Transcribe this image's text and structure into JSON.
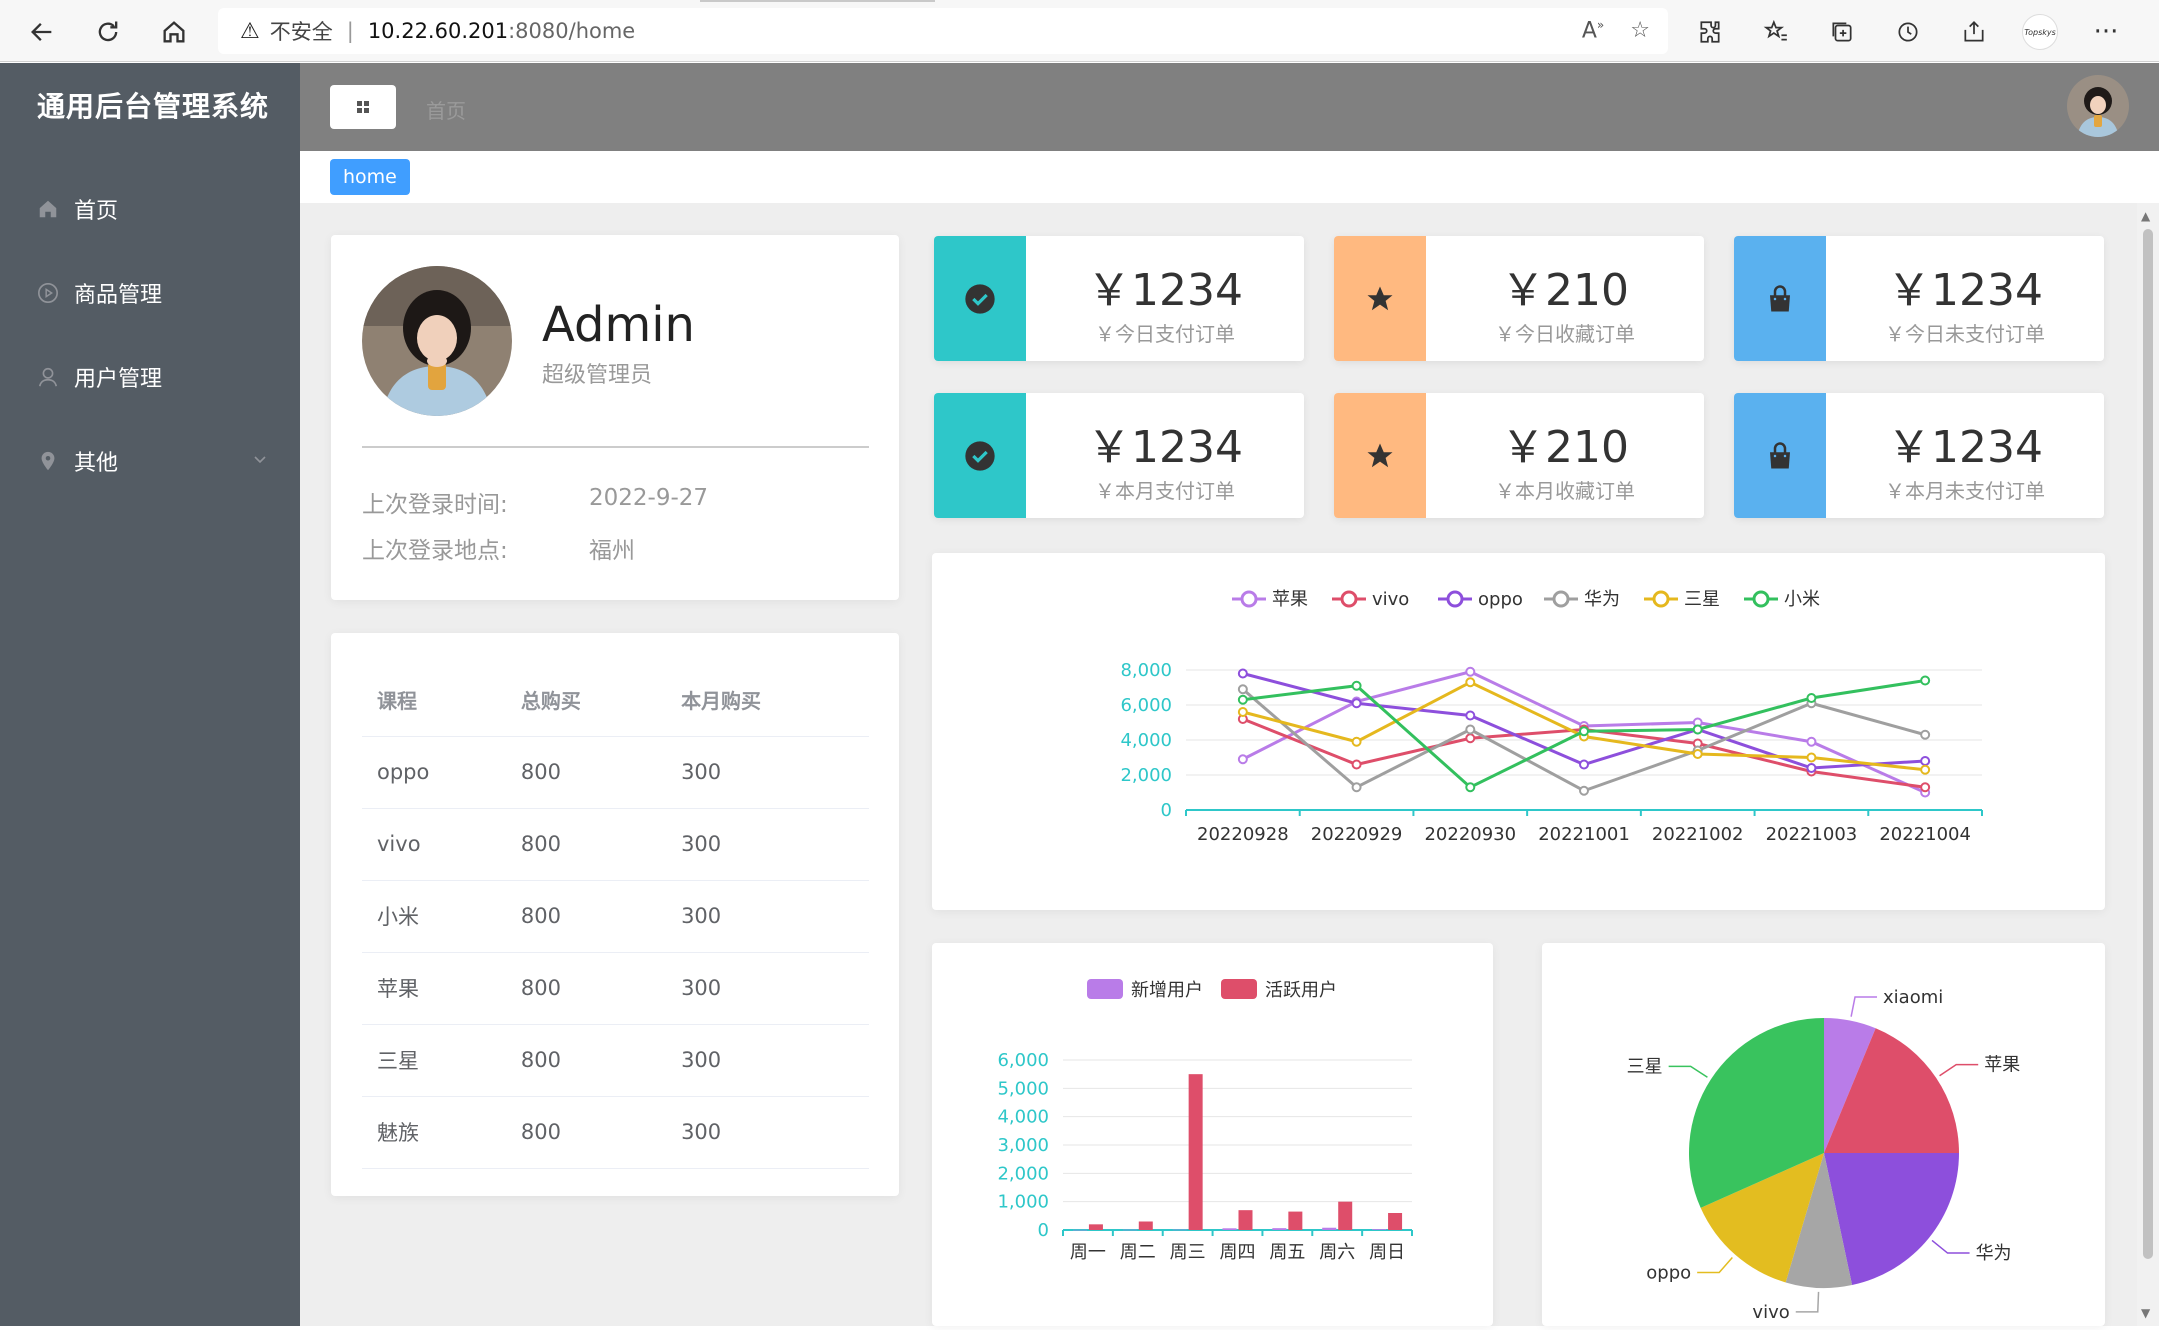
{
  "browser": {
    "insecure_label": "不安全",
    "url_host": "10.22.60.201",
    "url_port_path": ":8080/home",
    "profile_label": "Topskys"
  },
  "app": {
    "title": "通用后台管理系统",
    "menu": [
      {
        "label": "首页",
        "icon": "home-icon"
      },
      {
        "label": "商品管理",
        "icon": "play-circle-icon"
      },
      {
        "label": "用户管理",
        "icon": "user-icon"
      },
      {
        "label": "其他",
        "icon": "location-icon"
      }
    ],
    "breadcrumb": "首页",
    "tag": "home"
  },
  "user": {
    "name": "Admin",
    "role": "超级管理员",
    "last_login_time_label": "上次登录时间:",
    "last_login_time": "2022-9-27",
    "last_login_place_label": "上次登录地点:",
    "last_login_place": "福州"
  },
  "table": {
    "headers": [
      "课程",
      "总购买",
      "本月购买"
    ],
    "rows": [
      [
        "oppo",
        "800",
        "300"
      ],
      [
        "vivo",
        "800",
        "300"
      ],
      [
        "小米",
        "800",
        "300"
      ],
      [
        "苹果",
        "800",
        "300"
      ],
      [
        "三星",
        "800",
        "300"
      ],
      [
        "魅族",
        "800",
        "300"
      ]
    ]
  },
  "stats": [
    {
      "value": "￥1234",
      "label": "￥今日支付订单",
      "icon": "check-circle-icon",
      "color": "#2ec7c9"
    },
    {
      "value": "￥210",
      "label": "￥今日收藏订单",
      "icon": "star-icon",
      "color": "#ffb980"
    },
    {
      "value": "￥1234",
      "label": "￥今日未支付订单",
      "icon": "shopping-bag-icon",
      "color": "#5ab1ef"
    },
    {
      "value": "￥1234",
      "label": "￥本月支付订单",
      "icon": "check-circle-icon",
      "color": "#2ec7c9"
    },
    {
      "value": "￥210",
      "label": "￥本月收藏订单",
      "icon": "star-icon",
      "color": "#ffb980"
    },
    {
      "value": "￥1234",
      "label": "￥本月未支付订单",
      "icon": "shopping-bag-icon",
      "color": "#5ab1ef"
    }
  ],
  "chart_data": [
    {
      "type": "line",
      "legend_position": "top-center",
      "grid": true,
      "categories": [
        "20220928",
        "20220929",
        "20220930",
        "20221001",
        "20221002",
        "20221003",
        "20221004"
      ],
      "ylim": [
        0,
        8000
      ],
      "yticks": [
        "0",
        "2,000",
        "4,000",
        "6,000",
        "8,000"
      ],
      "series": [
        {
          "name": "苹果",
          "color": "#b97ce8",
          "values": [
            2900,
            6200,
            7900,
            4800,
            5000,
            3900,
            1000
          ]
        },
        {
          "name": "vivo",
          "color": "#de4e6a",
          "values": [
            5200,
            2600,
            4100,
            4600,
            3800,
            2200,
            1300
          ]
        },
        {
          "name": "oppo",
          "color": "#8d4fdc",
          "values": [
            7800,
            6100,
            5400,
            2600,
            4600,
            2400,
            2800
          ]
        },
        {
          "name": "华为",
          "color": "#9f9f9f",
          "values": [
            6900,
            1300,
            4600,
            1100,
            3400,
            6100,
            4300
          ]
        },
        {
          "name": "三星",
          "color": "#e5b81e",
          "values": [
            5600,
            3900,
            7300,
            4200,
            3200,
            3000,
            2300
          ]
        },
        {
          "name": "小米",
          "color": "#33c05e",
          "values": [
            6300,
            7100,
            1300,
            4500,
            4600,
            6400,
            7400
          ]
        }
      ]
    },
    {
      "type": "bar",
      "legend_position": "top-center",
      "grid": true,
      "categories": [
        "周一",
        "周二",
        "周三",
        "周四",
        "周五",
        "周六",
        "周日"
      ],
      "ylim": [
        0,
        6000
      ],
      "yticks": [
        "0",
        "1,000",
        "2,000",
        "3,000",
        "4,000",
        "5,000",
        "6,000"
      ],
      "series": [
        {
          "name": "新增用户",
          "color": "#b97ce8",
          "values": [
            5,
            10,
            12,
            60,
            65,
            80,
            30
          ]
        },
        {
          "name": "活跃用户",
          "color": "#de4e6a",
          "values": [
            200,
            300,
            5500,
            700,
            650,
            1000,
            600
          ]
        }
      ]
    },
    {
      "type": "pie",
      "slices": [
        {
          "name": "xiaomi",
          "color": "#b97ce8",
          "value": 1500
        },
        {
          "name": "苹果",
          "color": "#de4e6a",
          "value": 4500
        },
        {
          "name": "华为",
          "color": "#8d4fdc",
          "value": 5200
        },
        {
          "name": "vivo",
          "color": "#a6a6a6",
          "value": 1900
        },
        {
          "name": "oppo",
          "color": "#e3bd20",
          "value": 3300
        },
        {
          "name": "三星",
          "color": "#39c35e",
          "value": 7600
        }
      ]
    }
  ]
}
